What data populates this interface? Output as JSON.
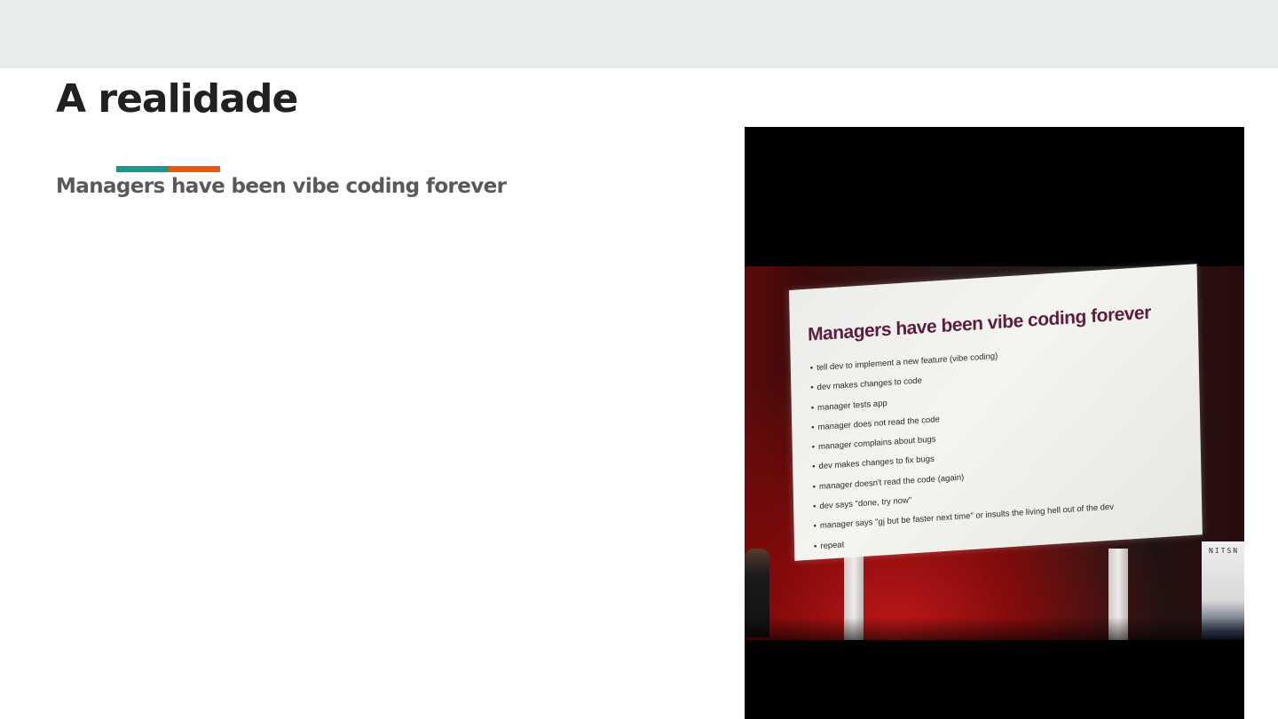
{
  "slide": {
    "title": "A realidade",
    "subtitle": "Managers have been vibe coding forever",
    "accent_colors": [
      "#1a998f",
      "#e8590c"
    ]
  },
  "photo": {
    "screen_title": "Managers have been vibe coding forever",
    "screen_bullets": [
      "tell dev to implement a new feature (vibe coding)",
      "dev makes changes to code",
      "manager tests app",
      "manager does not read the code",
      "manager complains about bugs",
      "dev makes changes to fix bugs",
      "manager doesn't read the code (again)",
      "dev says \"done, try now\"",
      "manager says \"gj but be faster next time\" or insults the living hell out of the dev",
      "repeat"
    ],
    "side_sign_text": "NITSN"
  }
}
